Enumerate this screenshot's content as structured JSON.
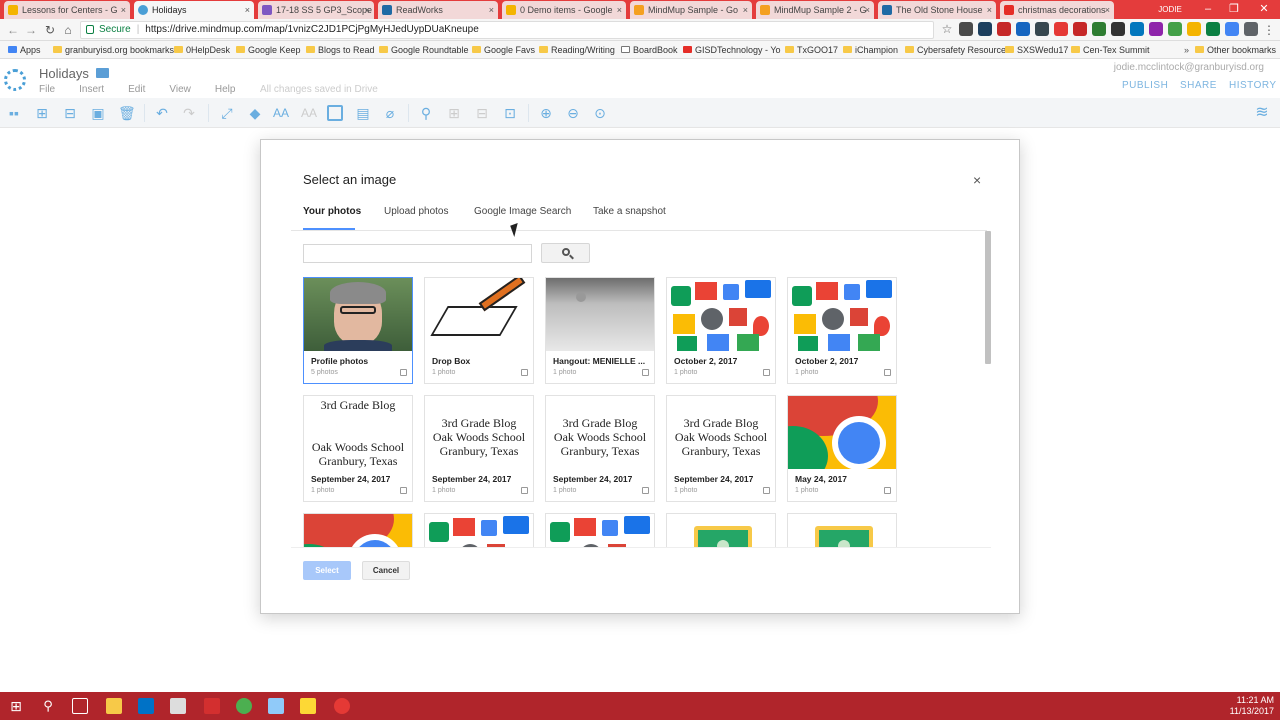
{
  "browser": {
    "tabs": [
      {
        "title": "Lessons for Centers - G",
        "color": "#f4b400",
        "active": false
      },
      {
        "title": "Holidays",
        "color": "#4a9fd6",
        "active": true
      },
      {
        "title": "17-18 SS 5 GP3_Scope",
        "color": "#7e57c2",
        "active": false
      },
      {
        "title": "ReadWorks",
        "color": "#1f6aa5",
        "active": false
      },
      {
        "title": "0 Demo items - Google",
        "color": "#f4b400",
        "active": false
      },
      {
        "title": "MindMup Sample - Go",
        "color": "#f4a020",
        "active": false
      },
      {
        "title": "MindMup Sample 2 - G",
        "color": "#f4a020",
        "active": false
      },
      {
        "title": "The Old Stone House",
        "color": "#1f6aa5",
        "active": false
      },
      {
        "title": "christmas decorations",
        "color": "#e52d27",
        "active": false
      }
    ],
    "profile_name": "JODIE",
    "address": {
      "secure_label": "Secure",
      "url": "https://drive.mindmup.com/map/1vnizC2JD1PCjPgMyHJedUypDUaKneupe"
    },
    "bookmarks": [
      {
        "label": "Apps"
      },
      {
        "label": "granburyisd.org bookmarks"
      },
      {
        "label": "0HelpDesk"
      },
      {
        "label": "Google Keep"
      },
      {
        "label": "Blogs to Read"
      },
      {
        "label": "Google Roundtable"
      },
      {
        "label": "Google Favs"
      },
      {
        "label": "Reading/Writing"
      },
      {
        "label": "BoardBook"
      },
      {
        "label": "GISDTechnology - Yo"
      },
      {
        "label": "TxGOO17"
      },
      {
        "label": "iChampion"
      },
      {
        "label": "Cybersafety Resource"
      },
      {
        "label": "SXSWedu17"
      },
      {
        "label": "Cen-Tex Summit"
      },
      {
        "label": "Other bookmarks"
      }
    ]
  },
  "app": {
    "title": "Holidays",
    "menu": [
      "File",
      "Insert",
      "Edit",
      "View",
      "Help"
    ],
    "save_status": "All changes saved in Drive",
    "user_email": "jodie.mcclintock@granburyisd.org",
    "actions": {
      "publish": "PUBLISH",
      "share": "SHARE",
      "history": "HISTORY"
    }
  },
  "dialog": {
    "title": "Select an image",
    "close": "×",
    "tabs": [
      "Your photos",
      "Upload photos",
      "Google Image Search",
      "Take a snapshot"
    ],
    "active_tab": "Your photos",
    "search": {
      "value": "",
      "placeholder": ""
    },
    "albums": [
      {
        "label": "Profile photos",
        "count": "5 photos",
        "thumb": "profile"
      },
      {
        "label": "Drop Box",
        "count": "1 photo",
        "thumb": "dropbox"
      },
      {
        "label": "Hangout: MENIELLE ...",
        "count": "1 photo",
        "thumb": "hangout"
      },
      {
        "label": "October 2, 2017",
        "count": "1 photo",
        "thumb": "gapps"
      },
      {
        "label": "October 2, 2017",
        "count": "1 photo",
        "thumb": "gapps"
      },
      {
        "label": "September 24, 2017",
        "count": "1 photo",
        "thumb": "blog1"
      },
      {
        "label": "September 24, 2017",
        "count": "1 photo",
        "thumb": "blog2"
      },
      {
        "label": "September 24, 2017",
        "count": "1 photo",
        "thumb": "blog2"
      },
      {
        "label": "September 24, 2017",
        "count": "1 photo",
        "thumb": "blog2"
      },
      {
        "label": "May 24, 2017",
        "count": "1 photo",
        "thumb": "chrome"
      },
      {
        "label": "",
        "count": "",
        "thumb": "chrome"
      },
      {
        "label": "",
        "count": "",
        "thumb": "gapps"
      },
      {
        "label": "",
        "count": "",
        "thumb": "gapps"
      },
      {
        "label": "",
        "count": "",
        "thumb": "classroom"
      },
      {
        "label": "",
        "count": "",
        "thumb": "classroom"
      }
    ],
    "blog_text": {
      "line1": "3rd Grade Blog",
      "line2": "Oak Woods School",
      "line3": "Granbury, Texas"
    },
    "buttons": {
      "select": "Select",
      "cancel": "Cancel"
    }
  },
  "taskbar": {
    "time": "11:21 AM",
    "date": "11/13/2017"
  },
  "colors": {
    "accent": "#4d90fe",
    "toolbar_icon": "#6aaee0",
    "tabstrip": "#e43c3c",
    "taskbar": "#b0252b"
  }
}
